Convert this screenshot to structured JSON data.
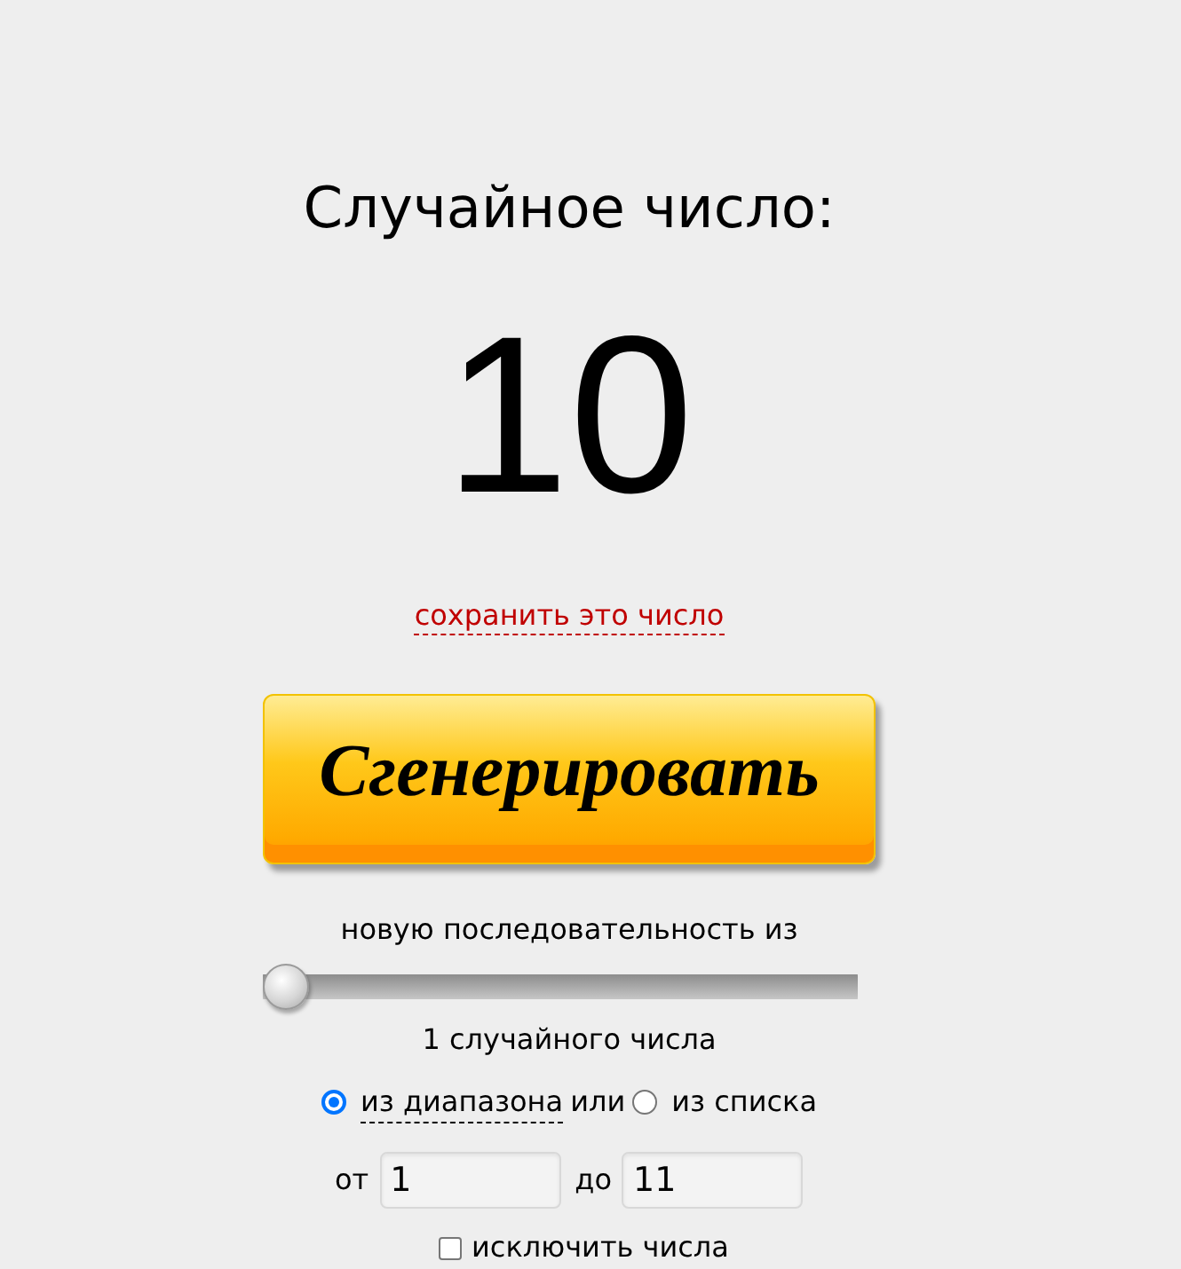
{
  "heading": "Случайное число:",
  "result": "10",
  "save_link": "сохранить это число",
  "generate_button": {
    "label": "Сгенерировать"
  },
  "count": {
    "label": "новую последовательность из",
    "level": 0,
    "reading": "1 случайного числа"
  },
  "source": {
    "options": [
      {
        "label": "из диапазона",
        "selected": true,
        "underlined": true
      },
      {
        "label": "из списка",
        "selected": false,
        "underlined": false
      }
    ],
    "separator": "или"
  },
  "range": {
    "from_label": "от",
    "from_value": "1",
    "to_label": "до",
    "to_value": "11"
  },
  "exclude": {
    "label": "исключить числа",
    "checked": false
  }
}
